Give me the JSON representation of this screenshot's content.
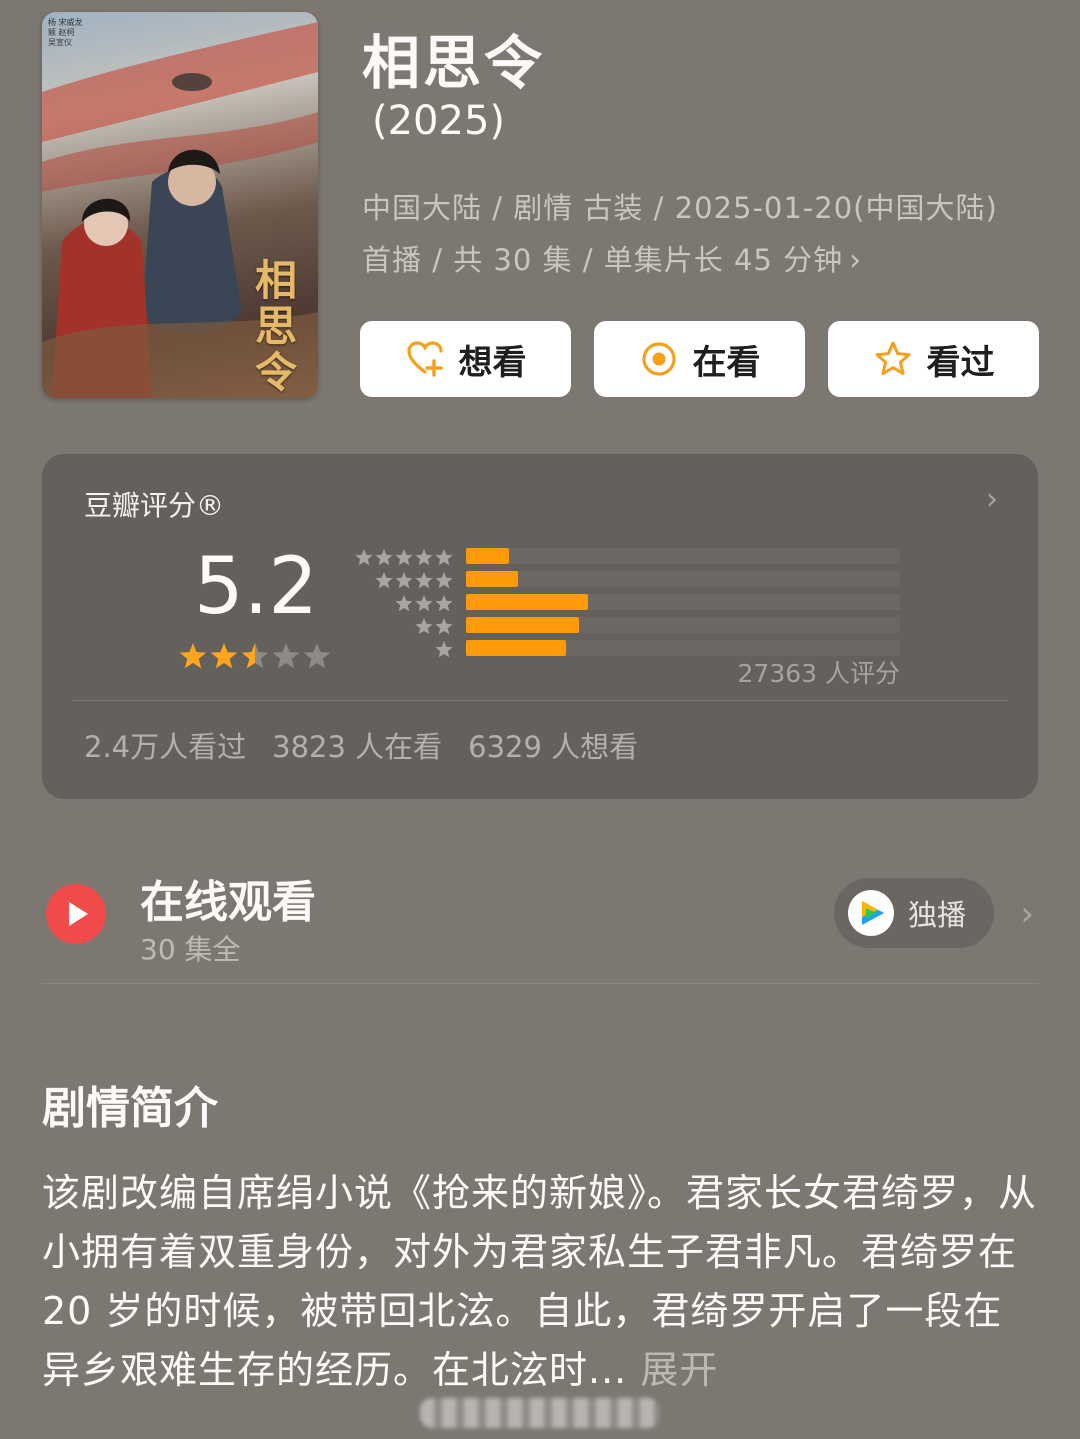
{
  "poster": {
    "title_art": "相思令",
    "credits": "杨 宋威龙 颖 赵柯 吴宣仪"
  },
  "show": {
    "title": "相思令",
    "year": "(2025)",
    "meta": "中国大陆 / 剧情 古装 / 2025-01-20(中国大陆) 首播 / 共 30 集 / 单集片长 45 分钟"
  },
  "actions": [
    {
      "label": "想看",
      "icon": "heart-plus-icon"
    },
    {
      "label": "在看",
      "icon": "target-circle-icon"
    },
    {
      "label": "看过",
      "icon": "star-outline-icon"
    }
  ],
  "rating": {
    "label": "豆瓣评分®",
    "score": "5.2",
    "stars_value": 2.5,
    "stars_max": 5,
    "distribution_fractions": [
      0.1,
      0.12,
      0.28,
      0.26,
      0.23
    ],
    "distribution_stars": [
      5,
      4,
      3,
      2,
      1
    ],
    "count_text": "27363 人评分",
    "stats": [
      "2.4万人看过",
      "3823 人在看",
      "6329 人想看"
    ]
  },
  "watch": {
    "title": "在线观看",
    "subtitle": "30 集全",
    "platform_badge": "独播",
    "platform_icon": "tencent-video-icon"
  },
  "synopsis": {
    "heading": "剧情简介",
    "text": "该剧改编自席绢小说《抢来的新娘》。君家长女君绮罗，从小拥有着双重身份，对外为君家私生子君非凡。君绮罗在 20 岁的时候，被带回北泫。自此，君绮罗开启了一段在异乡艰难生存的经历。在北泫时...",
    "expand_label": "展开"
  },
  "colors": {
    "background": "#7d7772",
    "card": "#64605c",
    "accent_orange": "#ff9a0a",
    "star_gold": "#ffa51f",
    "play_red": "#f04a4a"
  }
}
